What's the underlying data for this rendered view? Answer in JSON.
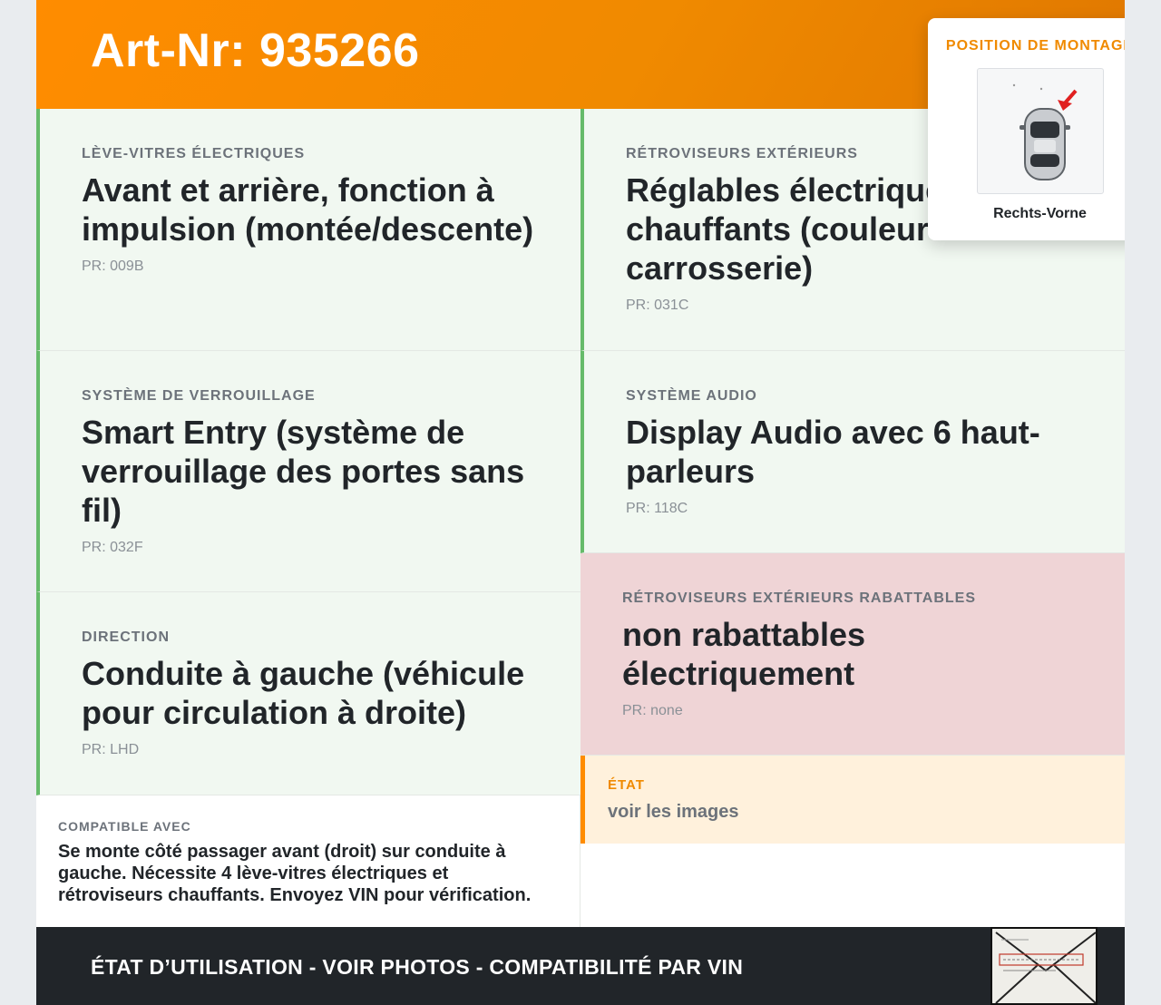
{
  "header": {
    "title": "Art-Nr: 935266"
  },
  "features": [
    {
      "label": "LÈVE-VITRES ÉLECTRIQUES",
      "value": "Avant et arrière, fonction à impulsion (montée/descente)",
      "pr": "PR: 009B",
      "status": "ok"
    },
    {
      "label": "SYSTÈME DE VERROUILLAGE",
      "value": "Smart Entry (système de verrouillage des portes sans fil)",
      "pr": "PR: 032F",
      "status": "ok"
    },
    {
      "label": "DIRECTION",
      "value": "Conduite à gauche (véhicule pour circulation à droite)",
      "pr": "PR: LHD",
      "status": "ok"
    },
    {
      "label": "RÉTROVISEURS EXTÉRIEURS",
      "value": "Réglables électriquement, chauffants (couleur carrosserie)",
      "pr": "PR: 031C",
      "status": "ok"
    },
    {
      "label": "SYSTÈME AUDIO",
      "value": "Display Audio avec 6 haut-parleurs",
      "pr": "PR: 118C",
      "status": "ok"
    },
    {
      "label": "RÉTROVISEURS EXTÉRIEURS RABATTABLES",
      "value": "non rabattables électriquement",
      "pr": "PR: none",
      "status": "mismatch"
    }
  ],
  "etat": {
    "label": "ÉTAT",
    "value": "voir les images"
  },
  "compatibility": {
    "label": "COMPATIBLE AVEC",
    "text": "Se monte côté passager avant (droit) sur conduite à gauche. Nécessite 4 lève-vitres électriques et rétroviseurs chauffants. Envoyez VIN pour vérification."
  },
  "footer": {
    "text": "ÉTAT D’UTILISATION - VOIR PHOTOS - COMPATIBILITÉ PAR VIN"
  },
  "mounting": {
    "title": "POSITION DE MONTAGE",
    "caption": "Rechts-Vorne"
  },
  "colors": {
    "accent": "#ff8c00",
    "ok_border": "#66bb6a",
    "ok_bg": "#f1f8f1",
    "mismatch_bg": "#efd4d6",
    "etat_bg": "#fff1dc",
    "footer_bg": "#212529"
  }
}
